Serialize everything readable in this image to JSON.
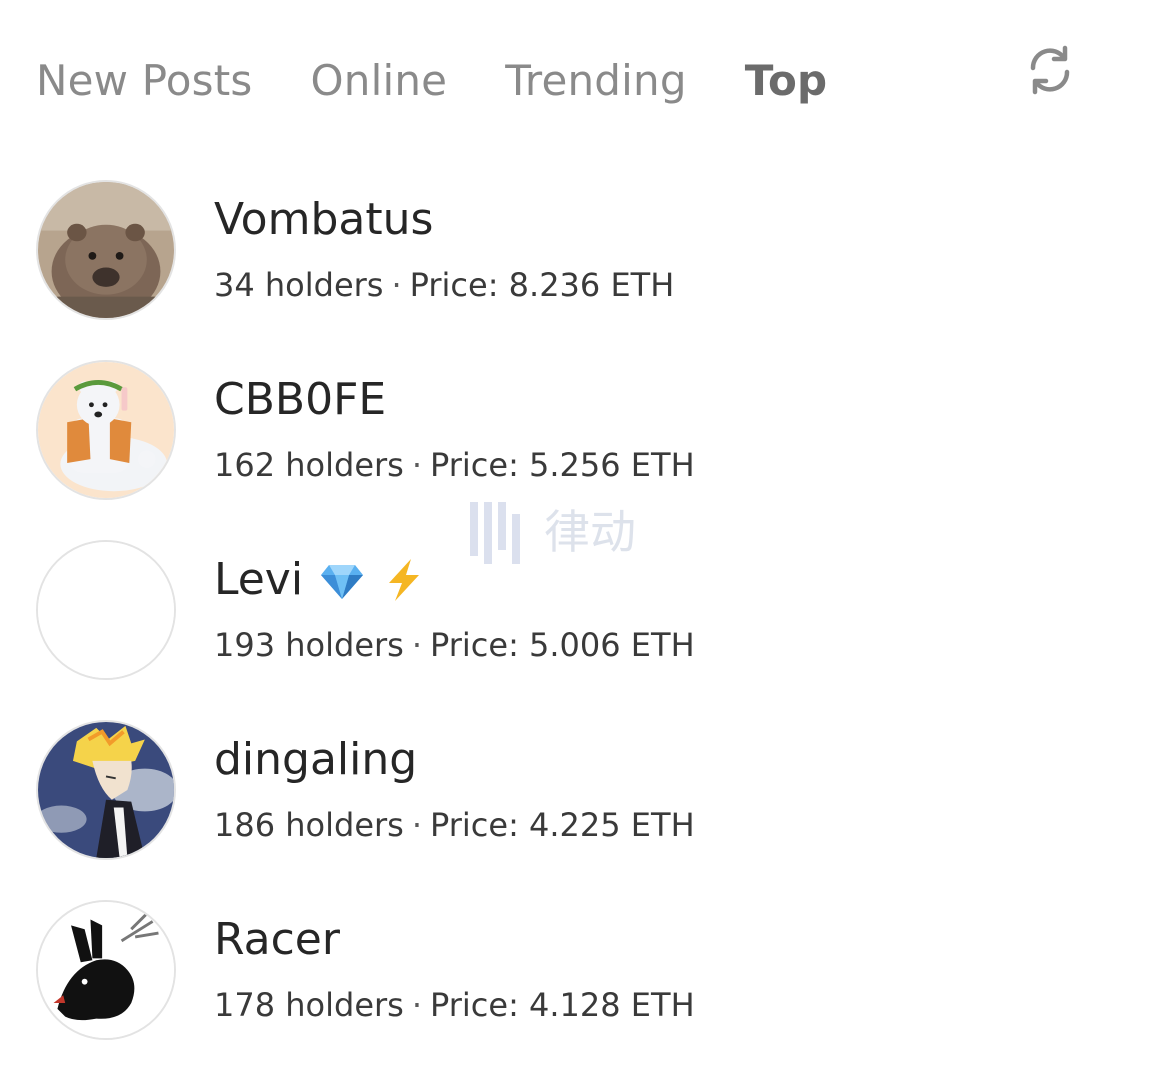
{
  "tabs": [
    {
      "label": "New Posts",
      "active": false
    },
    {
      "label": "Online",
      "active": false
    },
    {
      "label": "Trending",
      "active": false
    },
    {
      "label": "Top",
      "active": true
    }
  ],
  "refresh_icon": "refresh-icon",
  "users": [
    {
      "name": "Vombatus",
      "holders": "34 holders",
      "separator": "·",
      "price": "Price: 8.236 ETH",
      "avatar": "wombat-avatar"
    },
    {
      "name": "CBB0FE",
      "holders": "162 holders",
      "separator": "·",
      "price": "Price: 5.256 ETH",
      "avatar": "polar-bear-avatar"
    },
    {
      "name": "Levi",
      "holders": "193 holders",
      "separator": "·",
      "price": "Price: 5.006 ETH",
      "avatar": "blank-avatar",
      "badges": [
        "diamond-icon",
        "lightning-icon"
      ]
    },
    {
      "name": "dingaling",
      "holders": "186 holders",
      "separator": "·",
      "price": "Price: 4.225 ETH",
      "avatar": "anime-character-avatar"
    },
    {
      "name": "Racer",
      "holders": "178 holders",
      "separator": "·",
      "price": "Price: 4.128 ETH",
      "avatar": "black-rabbit-avatar"
    }
  ],
  "watermark": {
    "text": "律动"
  },
  "colors": {
    "inactive_tab": "#8a8a8a",
    "active_tab": "#6b6b6b",
    "name": "#262626",
    "meta": "#3a3a3a"
  }
}
